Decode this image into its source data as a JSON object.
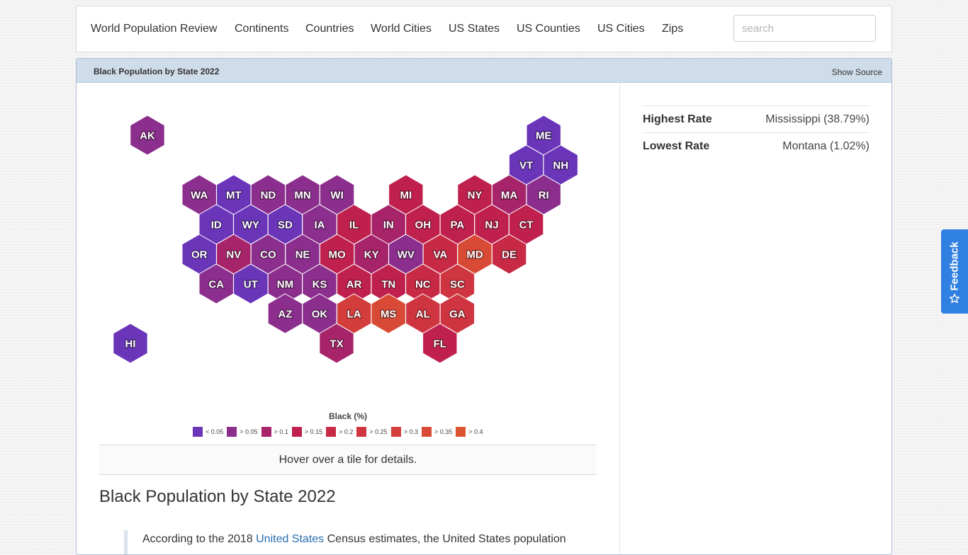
{
  "nav": {
    "brand": "World Population Review",
    "items": [
      "Continents",
      "Countries",
      "World Cities",
      "US States",
      "US Counties",
      "US Cities",
      "Zips"
    ],
    "search_placeholder": "search"
  },
  "panel": {
    "title": "Black Population by State 2022",
    "show_source": "Show Source"
  },
  "map": {
    "tiles": [
      {
        "state": "AK",
        "bin": 1
      },
      {
        "state": "ME",
        "bin": 0
      },
      {
        "state": "VT",
        "bin": 0
      },
      {
        "state": "NH",
        "bin": 0
      },
      {
        "state": "WA",
        "bin": 1
      },
      {
        "state": "MT",
        "bin": 0
      },
      {
        "state": "ND",
        "bin": 1
      },
      {
        "state": "MN",
        "bin": 1
      },
      {
        "state": "WI",
        "bin": 1
      },
      {
        "state": "MI",
        "bin": 3
      },
      {
        "state": "NY",
        "bin": 3
      },
      {
        "state": "MA",
        "bin": 2
      },
      {
        "state": "RI",
        "bin": 1
      },
      {
        "state": "ID",
        "bin": 0
      },
      {
        "state": "WY",
        "bin": 0
      },
      {
        "state": "SD",
        "bin": 0
      },
      {
        "state": "IA",
        "bin": 1
      },
      {
        "state": "IL",
        "bin": 3
      },
      {
        "state": "IN",
        "bin": 2
      },
      {
        "state": "OH",
        "bin": 3
      },
      {
        "state": "PA",
        "bin": 3
      },
      {
        "state": "NJ",
        "bin": 3
      },
      {
        "state": "CT",
        "bin": 3
      },
      {
        "state": "OR",
        "bin": 0
      },
      {
        "state": "NV",
        "bin": 2
      },
      {
        "state": "CO",
        "bin": 1
      },
      {
        "state": "NE",
        "bin": 1
      },
      {
        "state": "MO",
        "bin": 3
      },
      {
        "state": "KY",
        "bin": 2
      },
      {
        "state": "WV",
        "bin": 1
      },
      {
        "state": "VA",
        "bin": 4
      },
      {
        "state": "MD",
        "bin": 7
      },
      {
        "state": "DE",
        "bin": 4
      },
      {
        "state": "CA",
        "bin": 1
      },
      {
        "state": "UT",
        "bin": 0
      },
      {
        "state": "NM",
        "bin": 1
      },
      {
        "state": "KS",
        "bin": 1
      },
      {
        "state": "AR",
        "bin": 3
      },
      {
        "state": "TN",
        "bin": 3
      },
      {
        "state": "NC",
        "bin": 4
      },
      {
        "state": "SC",
        "bin": 5
      },
      {
        "state": "AZ",
        "bin": 1
      },
      {
        "state": "OK",
        "bin": 1
      },
      {
        "state": "LA",
        "bin": 6
      },
      {
        "state": "MS",
        "bin": 7
      },
      {
        "state": "AL",
        "bin": 5
      },
      {
        "state": "GA",
        "bin": 5
      },
      {
        "state": "HI",
        "bin": 0
      },
      {
        "state": "TX",
        "bin": 2
      },
      {
        "state": "FL",
        "bin": 3
      }
    ]
  },
  "legend": {
    "title": "Black (%)",
    "entries": [
      {
        "label": "< 0.05",
        "color": "#6a35b8"
      },
      {
        "label": "> 0.05",
        "color": "#8b2e8d"
      },
      {
        "label": "> 0.1",
        "color": "#a8246a"
      },
      {
        "label": "> 0.15",
        "color": "#c0204e"
      },
      {
        "label": "> 0.2",
        "color": "#c82a45"
      },
      {
        "label": "> 0.25",
        "color": "#cf3540"
      },
      {
        "label": "> 0.3",
        "color": "#d33d3c"
      },
      {
        "label": "> 0.35",
        "color": "#d84a36"
      },
      {
        "label": "> 0.4",
        "color": "#dc5530"
      }
    ]
  },
  "hover_hint": "Hover over a tile for details.",
  "stats": {
    "highest_label": "Highest Rate",
    "highest_value": "Mississippi (38.79%)",
    "lowest_label": "Lowest Rate",
    "lowest_value": "Montana (1.02%)"
  },
  "article": {
    "title": "Black Population by State 2022",
    "quote_prefix": "According to the 2018 ",
    "quote_link": "United States",
    "quote_suffix": " Census estimates, the United States population"
  },
  "feedback": "Feedback"
}
